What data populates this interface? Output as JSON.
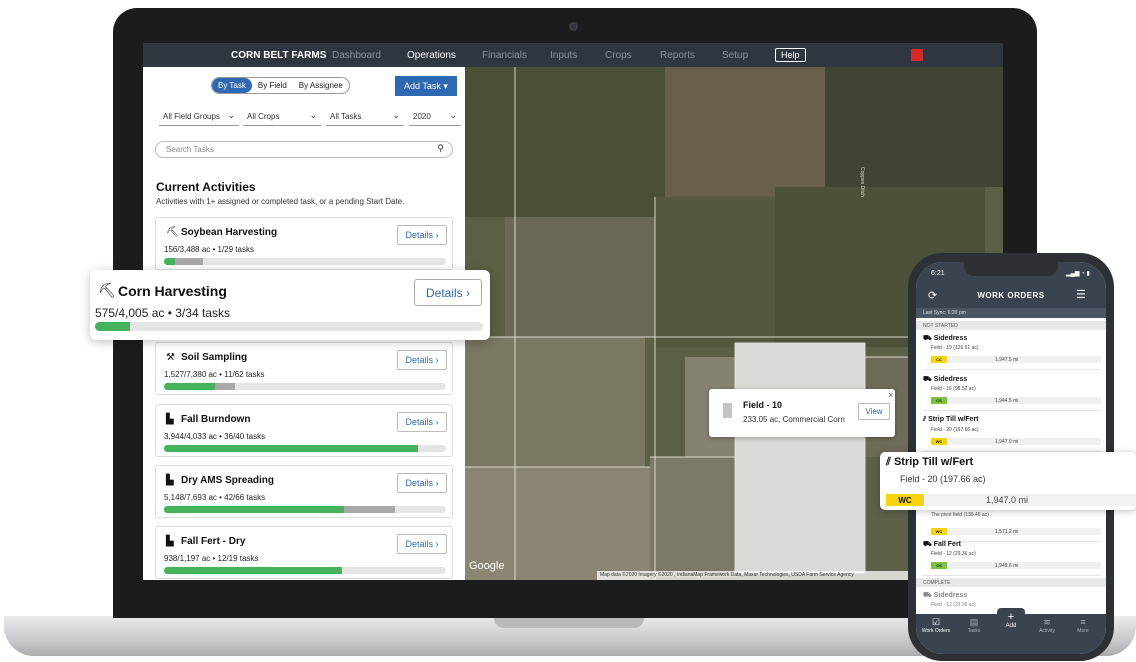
{
  "nav": {
    "brand": "CORN BELT FARMS",
    "items": [
      "Dashboard",
      "Operations",
      "Financials",
      "Inputs",
      "Crops",
      "Reports",
      "Setup"
    ],
    "help": "Help"
  },
  "sidebar": {
    "view_toggle": [
      "By Task",
      "By Field",
      "By Assignee"
    ],
    "add_task": "Add Task",
    "filters": [
      "All Field Groups",
      "All Crops",
      "All Tasks",
      "2020"
    ],
    "search_placeholder": "Search Tasks",
    "section_title": "Current Activities",
    "section_sub": "Activities with 1+ assigned or completed task, or a pending Start Date.",
    "details_label": "Details",
    "activities": [
      {
        "title": "Soybean Harvesting",
        "stats": "156/3,488 ac • 1/29 tasks",
        "completed": 0.04,
        "assigned": 0.14
      },
      {
        "title": "Corn Harvesting",
        "stats": "575/4,005 ac • 3/34 tasks",
        "completed": 0.09,
        "assigned": 0.09
      },
      {
        "title": "Soil Sampling",
        "stats": "1,527/7,380 ac • 11/62 tasks",
        "completed": 0.18,
        "assigned": 0.25
      },
      {
        "title": "Fall Burndown",
        "stats": "3,944/4,033 ac • 36/40 tasks",
        "completed": 0.9,
        "assigned": 0.9
      },
      {
        "title": "Dry AMS Spreading",
        "stats": "5,148/7,693 ac • 42/66 tasks",
        "completed": 0.64,
        "assigned": 0.82
      },
      {
        "title": "Fall Fert - Dry",
        "stats": "938/1,197 ac • 12/19 tasks",
        "completed": 0.63,
        "assigned": 0.63
      }
    ]
  },
  "map": {
    "popup": {
      "title": "Field - 10",
      "sub": "233.05 ac, Commercial Corn",
      "view": "View"
    },
    "google": "Google",
    "credit": "Map data ©2020 Imagery ©2020 , IndianaMap Framework Data, Maxar Technologies, USDA Farm Service Agency"
  },
  "phone": {
    "time": "6:21",
    "title": "WORK ORDERS",
    "last_sync": "Last Sync: 6:20 pm",
    "sections": [
      "NOT STARTED",
      "COMPLETE"
    ],
    "orders": [
      {
        "title": "Sidedress",
        "field": "Field - 19 (126.61 ac)",
        "tag": "CC",
        "miles": "1,947.5 mi"
      },
      {
        "title": "Sidedress",
        "field": "Field - 16 (98.52 ac)",
        "tag": "CS",
        "miles": "1,944.5 mi"
      },
      {
        "title": "Strip Till w/Fert",
        "field": "Field - 20 (197.66 ac)",
        "tag": "WC",
        "miles": "1,947.0 mi"
      },
      {
        "title": "",
        "field": "The pivot field (139.46 ac)",
        "tag": "WC",
        "miles": "1,571.2 mi"
      },
      {
        "title": "Fall Fert",
        "field": "Field - 12 (29.36 ac)",
        "tag": "CS",
        "miles": "1,949.6 mi"
      },
      {
        "title": "Sidedress",
        "field": "Field - 12 (29.36 ac)",
        "tag": "",
        "miles": ""
      }
    ],
    "tabs": [
      "Work Orders",
      "Tasks",
      "Add",
      "Activity",
      "More"
    ],
    "callout": {
      "title": "Strip Till w/Fert",
      "field": "Field - 20 (197.66 ac)",
      "tag": "WC",
      "miles": "1,947.0 mi"
    }
  },
  "colors": {
    "accent": "#2f68b2",
    "progress": "#44b35b",
    "cc": "#f5d30f",
    "cs": "#7cc142"
  }
}
